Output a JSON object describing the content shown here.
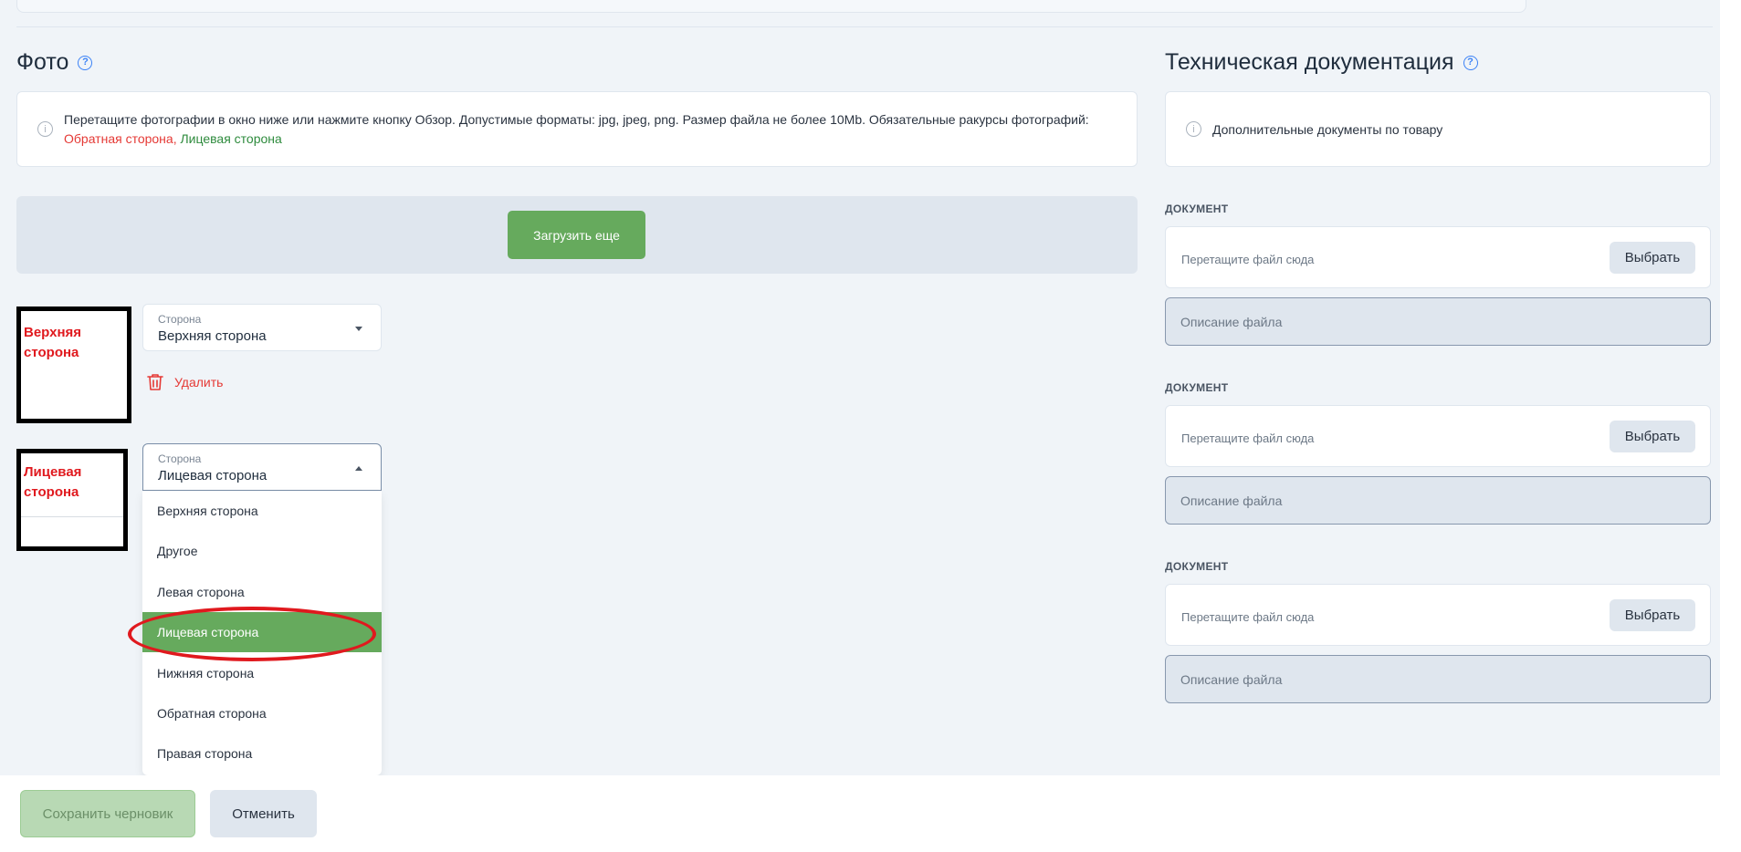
{
  "photo": {
    "title": "Фото",
    "info_text": "Перетащите фотографии в окно ниже или нажмите кнопку Обзор. Допустимые форматы: jpg, jpeg, png. Размер файла не более 10Mb. Обязательные ракурсы фотографий: ",
    "required_1": "Обратная сторона,",
    "required_2": "Лицевая сторона",
    "upload_more": "Загрузить еще",
    "items": [
      {
        "thumb_text": "Верхняя сторона",
        "select_label": "Сторона",
        "select_value": "Верхняя сторона",
        "delete_label": "Удалить"
      },
      {
        "thumb_text": "Лицевая сторона",
        "select_label": "Сторона",
        "select_value": "Лицевая сторона"
      }
    ],
    "dropdown_options": [
      "Верхняя сторона",
      "Другое",
      "Левая сторона",
      "Лицевая сторона",
      "Нижняя сторона",
      "Обратная сторона",
      "Правая сторона"
    ],
    "dropdown_selected": "Лицевая сторона"
  },
  "tech_docs": {
    "title": "Техническая документация",
    "info_text": "Дополнительные документы по товару",
    "documents": [
      {
        "label": "ДОКУМЕНТ",
        "drop_text": "Перетащите файл сюда",
        "choose_label": "Выбрать",
        "desc_placeholder": "Описание файла"
      },
      {
        "label": "ДОКУМЕНТ",
        "drop_text": "Перетащите файл сюда",
        "choose_label": "Выбрать",
        "desc_placeholder": "Описание файла"
      },
      {
        "label": "ДОКУМЕНТ",
        "drop_text": "Перетащите файл сюда",
        "choose_label": "Выбрать",
        "desc_placeholder": "Описание файла"
      }
    ]
  },
  "footer": {
    "save_draft": "Сохранить черновик",
    "cancel": "Отменить"
  },
  "colors": {
    "accent_green": "#66aa5d",
    "required_red": "#e53935",
    "required_green": "#2e8b3d",
    "annotation_red": "#e0191e",
    "help_blue": "#3b82f6"
  },
  "icons": [
    "help-icon",
    "info-icon",
    "trash-icon",
    "caret-down-icon",
    "caret-up-icon"
  ]
}
